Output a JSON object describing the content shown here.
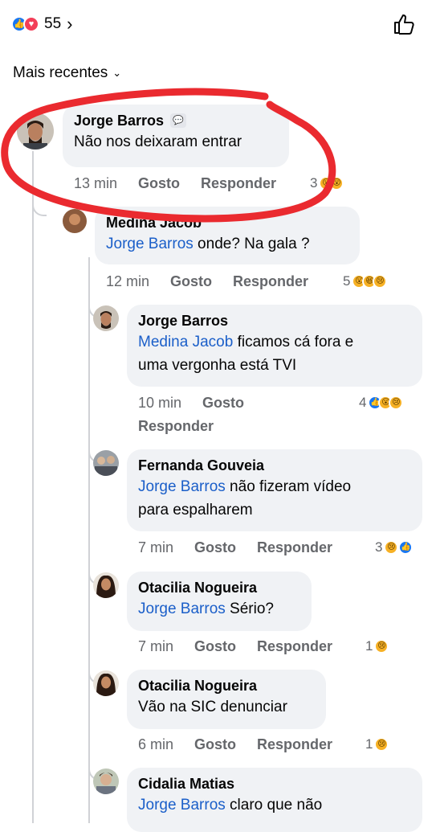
{
  "top": {
    "count": "55",
    "chevron": "›"
  },
  "sort": {
    "label": "Mais recentes",
    "chevron": "⌄"
  },
  "comments": [
    {
      "author": "Jorge Barros",
      "mention": "",
      "text": "Não nos deixaram entrar",
      "time": "13 min",
      "like": "Gosto",
      "reply": "Responder",
      "reactions": "3"
    },
    {
      "author": "Medina Jacob",
      "mention": "Jorge Barros",
      "text": " onde? Na gala ?",
      "time": "12 min",
      "like": "Gosto",
      "reply": "Responder",
      "reactions": "5"
    },
    {
      "author": "Jorge Barros",
      "mention": "Medina Jacob",
      "text1": " ficamos cá fora e",
      "text2": "uma vergonha está TVI",
      "time": "10 min",
      "like": "Gosto",
      "reply": "Responder",
      "reactions": "4"
    },
    {
      "author": "Fernanda Gouveia",
      "mention": "Jorge Barros",
      "text1": " não fizeram vídeo",
      "text2": "para espalharem",
      "time": "7 min",
      "like": "Gosto",
      "reply": "Responder",
      "reactions": "3"
    },
    {
      "author": "Otacilia Nogueira",
      "mention": "Jorge Barros",
      "text": " Sério?",
      "time": "7 min",
      "like": "Gosto",
      "reply": "Responder",
      "reactions": "1"
    },
    {
      "author": "Otacilia Nogueira",
      "mention": "",
      "text": "Vão na SIC denunciar",
      "time": "6 min",
      "like": "Gosto",
      "reply": "Responder",
      "reactions": "1"
    },
    {
      "author": "Cidalia Matias",
      "mention": "Jorge Barros",
      "text": " claro que não"
    }
  ],
  "colors": {
    "like_blue": "#1877f2",
    "love_red": "#f33e58",
    "emoji_yellow": "#f7b125",
    "annotation_red": "#ea2a2f",
    "mention": "#1b5fc9"
  },
  "icons": {
    "top_like": "thumbs-up-outline-icon",
    "badge": "messenger-badge-icon"
  }
}
